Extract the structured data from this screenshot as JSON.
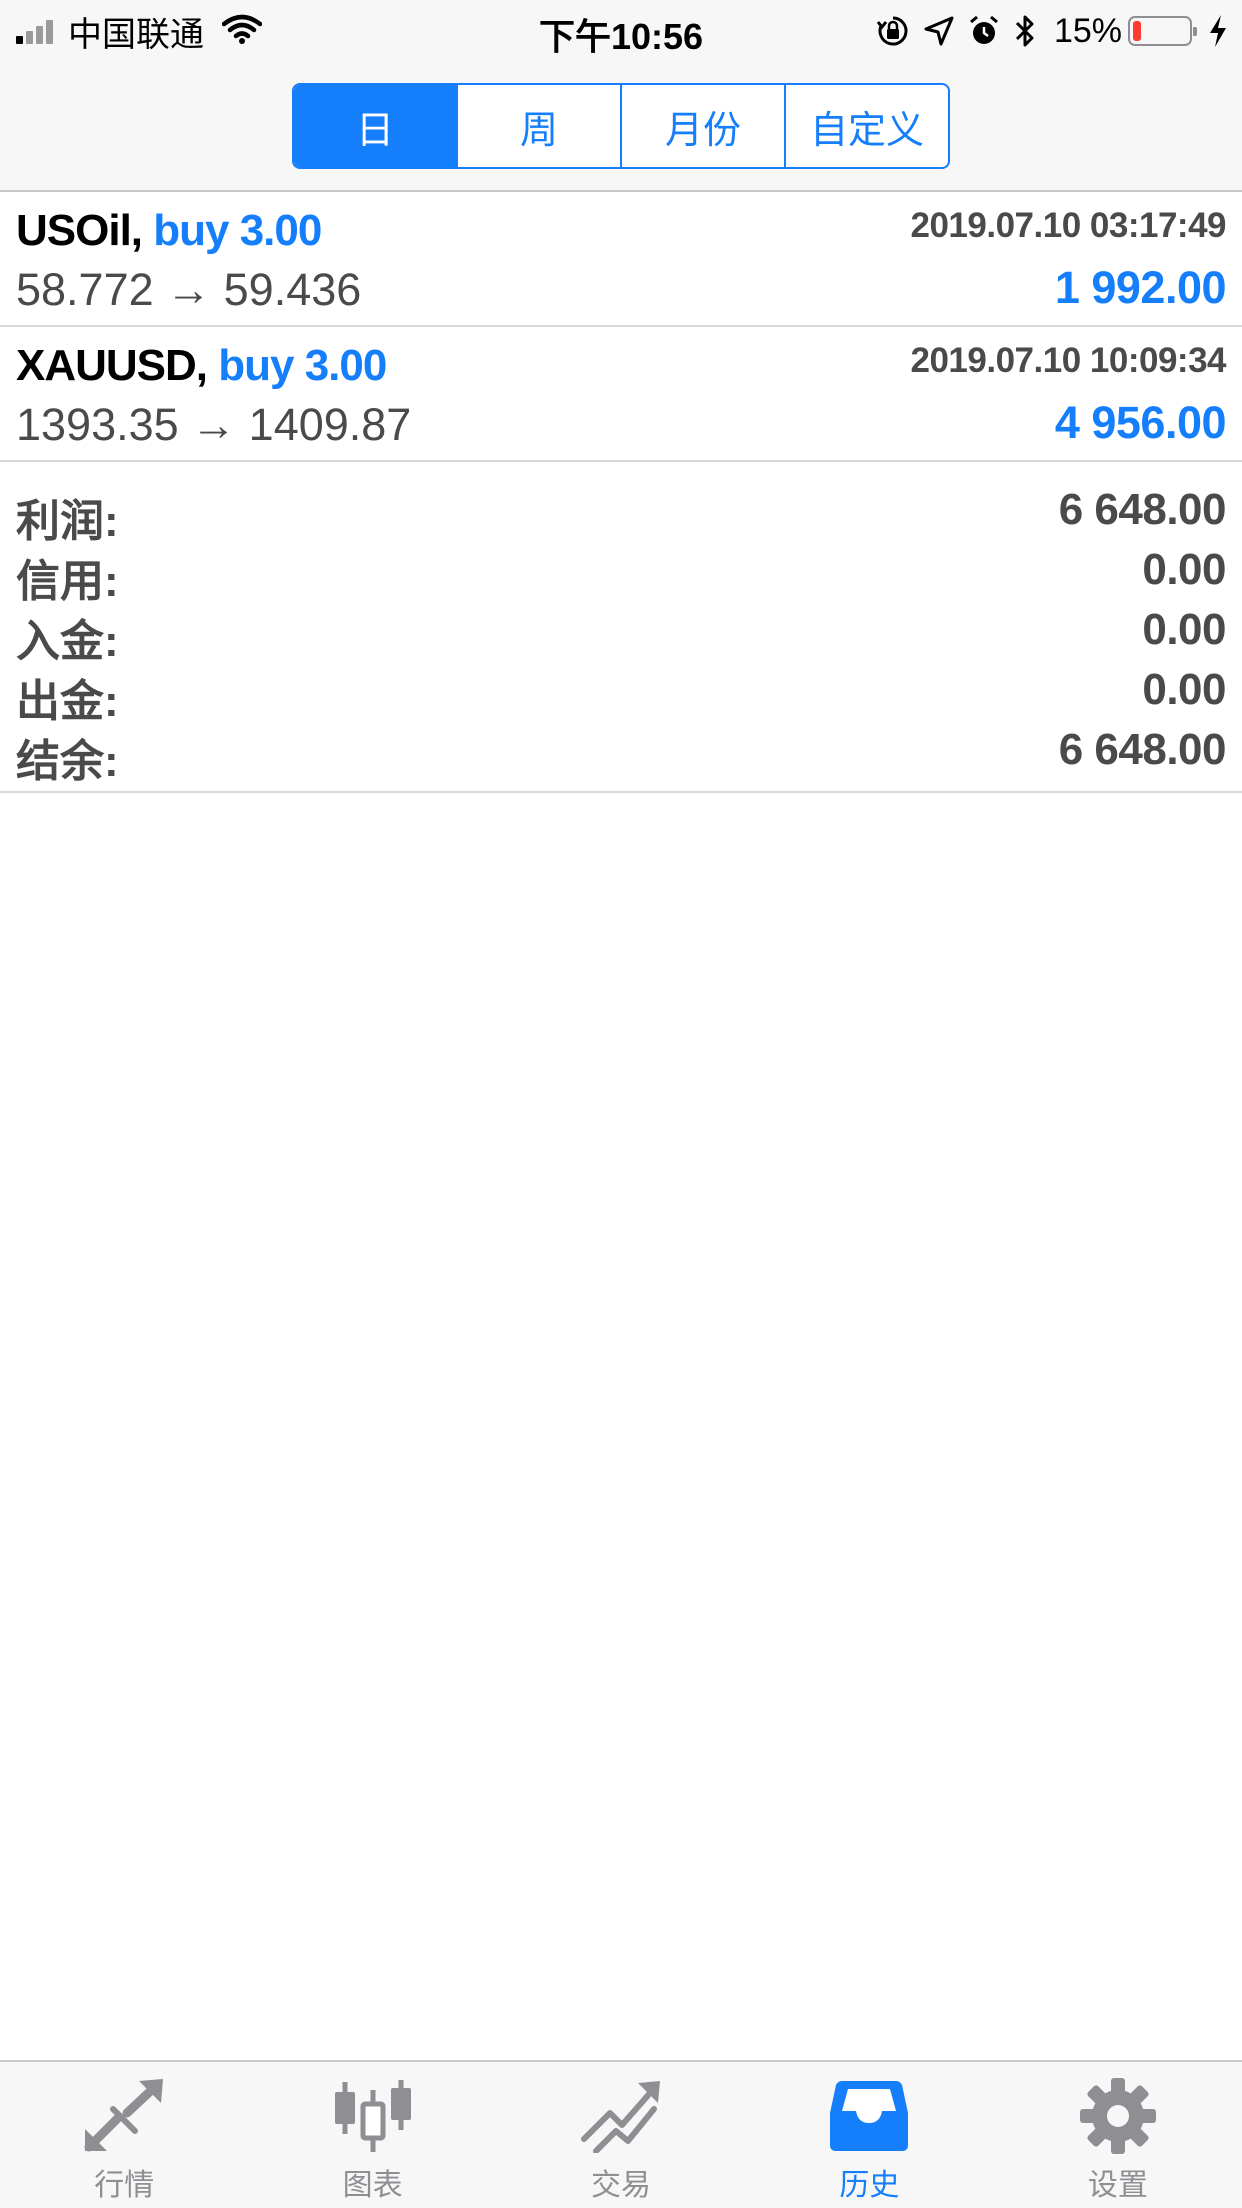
{
  "status_bar": {
    "carrier": "中国联通",
    "time": "下午10:56",
    "battery_percent": "15%",
    "battery_level": 0.15,
    "icons": [
      "signal-icon",
      "wifi-icon",
      "rotation-lock-icon",
      "location-icon",
      "alarm-icon",
      "bluetooth-icon",
      "battery-icon",
      "charging-icon"
    ]
  },
  "segments": {
    "items": [
      "日",
      "周",
      "月份",
      "自定义"
    ],
    "selected": "日"
  },
  "trades": [
    {
      "symbol": "USOil,",
      "action": "buy 3.00",
      "time": "2019.07.10 03:17:49",
      "prices": "58.772 → 59.436",
      "profit": "1 992.00"
    },
    {
      "symbol": "XAUUSD,",
      "action": "buy 3.00",
      "time": "2019.07.10 10:09:34",
      "prices": "1393.35 → 1409.87",
      "profit": "4 956.00"
    }
  ],
  "summary": [
    {
      "label": "利润:",
      "value": "6 648.00"
    },
    {
      "label": "信用:",
      "value": "0.00"
    },
    {
      "label": "入金:",
      "value": "0.00"
    },
    {
      "label": "出金:",
      "value": "0.00"
    },
    {
      "label": "结余:",
      "value": "6 648.00"
    }
  ],
  "tabbar": {
    "items": [
      {
        "label": "行情",
        "icon": "quotes-arrows-icon"
      },
      {
        "label": "图表",
        "icon": "candlestick-chart-icon"
      },
      {
        "label": "交易",
        "icon": "trade-trend-icon"
      },
      {
        "label": "历史",
        "icon": "history-inbox-icon"
      },
      {
        "label": "设置",
        "icon": "gear-icon"
      }
    ],
    "active": "历史"
  },
  "colors": {
    "accent": "#157efb",
    "text_gray": "#4a4a4a",
    "inactive_gray": "#8e8e93",
    "battery_low": "#ff3b30"
  }
}
